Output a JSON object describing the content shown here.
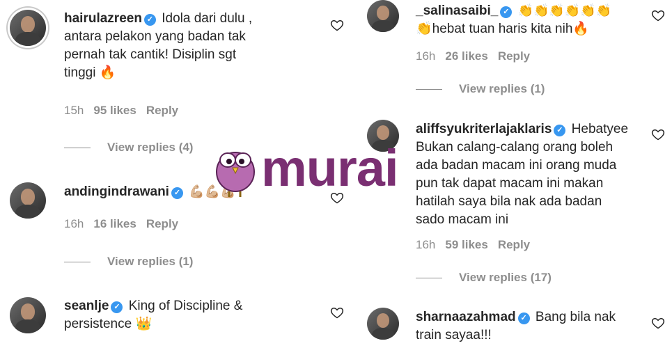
{
  "left_comments": [
    {
      "username": "hairulazreen",
      "text_lines": [
        "Idola dari dulu ,",
        "antara pelakon yang badan tak",
        "pernah tak cantik! Disiplin sgt",
        "tinggi 🔥"
      ],
      "time": "15h",
      "likes": "95 likes",
      "reply": "Reply",
      "view_replies": "View replies (4)"
    },
    {
      "username": "andingindrawani",
      "text_lines": [
        "💪🏼💪🏼💪🏼"
      ],
      "time": "16h",
      "likes": "16 likes",
      "reply": "Reply",
      "view_replies": "View replies (1)"
    },
    {
      "username": "seanlje",
      "text_lines": [
        "King of Discipline &",
        "persistence 👑"
      ]
    }
  ],
  "right_comments": [
    {
      "username": "_salinasaibi_",
      "text_lines": [
        "👏👏👏👏👏👏",
        "👏hebat tuan haris kita nih🔥"
      ],
      "time": "16h",
      "likes": "26 likes",
      "reply": "Reply",
      "view_replies": "View replies (1)"
    },
    {
      "username": "aliffsyukriterlajaklaris",
      "text_lines": [
        "Hebatyee",
        "Bukan calang-calang orang boleh",
        "ada badan macam ini orang muda",
        "pun tak dapat macam ini makan",
        "hatilah saya bila nak ada badan",
        "sado macam ini"
      ],
      "time": "16h",
      "likes": "59 likes",
      "reply": "Reply",
      "view_replies": "View replies (17)"
    },
    {
      "username": "sharnaazahmad",
      "text_lines": [
        "Bang bila nak",
        "train sayaa!!!"
      ]
    }
  ],
  "watermark": {
    "text": "murai",
    "color": "#7a2f72"
  },
  "icons": {
    "heart": "heart-outline-icon",
    "verified": "verified-badge-icon"
  }
}
